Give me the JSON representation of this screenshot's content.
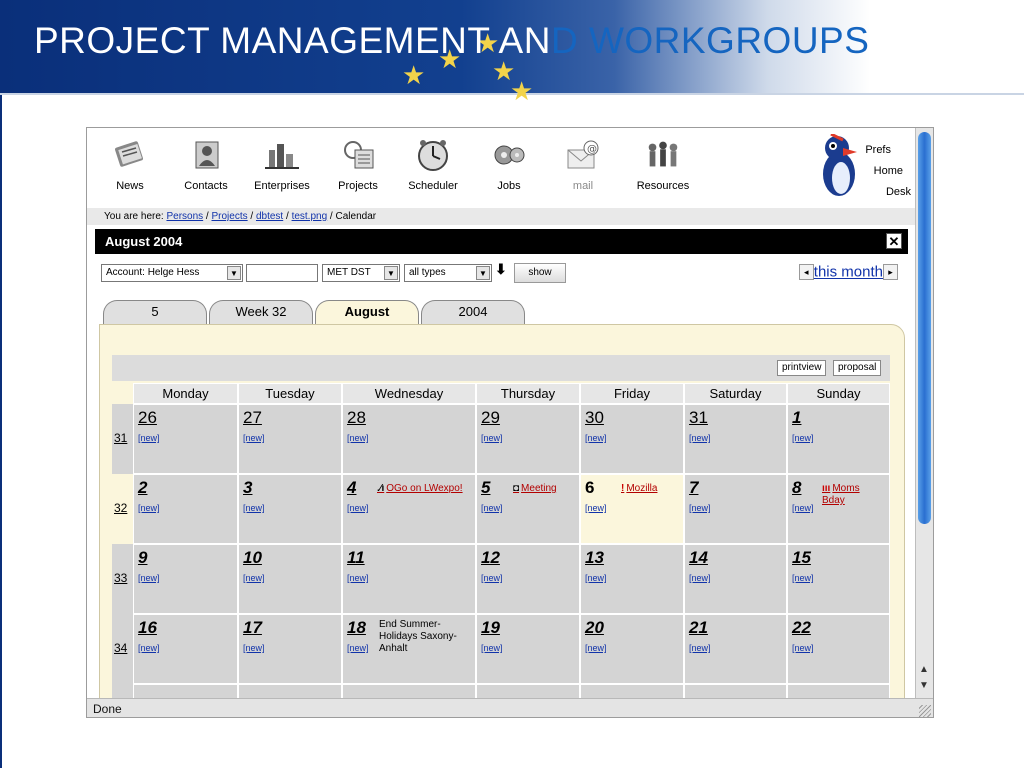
{
  "slide": {
    "title_part1": "PROJECT MANAGEMENT AN",
    "title_part2": "D WORKGROUPS"
  },
  "toolbar": {
    "items": [
      {
        "label": "News",
        "icon": "news-icon"
      },
      {
        "label": "Contacts",
        "icon": "contacts-icon"
      },
      {
        "label": "Enterprises",
        "icon": "enterprises-icon"
      },
      {
        "label": "Projects",
        "icon": "projects-icon"
      },
      {
        "label": "Scheduler",
        "icon": "scheduler-icon"
      },
      {
        "label": "Jobs",
        "icon": "jobs-icon"
      },
      {
        "label": "mail",
        "icon": "mail-icon"
      },
      {
        "label": "Resources",
        "icon": "resources-icon"
      }
    ],
    "prefs": "Prefs",
    "home": "Home",
    "desk": "Desk"
  },
  "breadcrumb": {
    "prefix": "You are here: ",
    "links": [
      "Persons",
      "Projects",
      "dbtest",
      "test.png"
    ],
    "current": "Calendar"
  },
  "panel": {
    "title": "August 2004",
    "close": "✕"
  },
  "filters": {
    "account": "Account: Helge Hess",
    "timezone": "MET DST",
    "types": "all types",
    "show_label": "show",
    "month_link": "this month",
    "prev": "◂",
    "next": "▸"
  },
  "tabs": [
    {
      "label": "5",
      "active": false
    },
    {
      "label": "Week 32",
      "active": false
    },
    {
      "label": "August",
      "active": true
    },
    {
      "label": "2004",
      "active": false
    }
  ],
  "actions": {
    "printview": "printview",
    "proposal": "proposal"
  },
  "calendar": {
    "days": [
      "Monday",
      "Tuesday",
      "Wednesday",
      "Thursday",
      "Friday",
      "Saturday",
      "Sunday"
    ],
    "new_label": "[new]",
    "weeks": [
      {
        "week": "31",
        "dates": [
          "26",
          "27",
          "28",
          "29",
          "30",
          "31",
          "1"
        ]
      },
      {
        "week": "32",
        "dates": [
          "2",
          "3",
          "4",
          "5",
          "6",
          "7",
          "8"
        ]
      },
      {
        "week": "33",
        "dates": [
          "9",
          "10",
          "11",
          "12",
          "13",
          "14",
          "15"
        ]
      },
      {
        "week": "34",
        "dates": [
          "16",
          "17",
          "18",
          "19",
          "20",
          "21",
          "22"
        ]
      }
    ],
    "events": {
      "e1": "OGo on LWexpo!",
      "e2": "Meeting",
      "e3": "Mozilla",
      "e4": "Moms Bday",
      "h1": "End Summer-Holidays Saxony-Anhalt"
    }
  },
  "status": {
    "text": "Done"
  }
}
